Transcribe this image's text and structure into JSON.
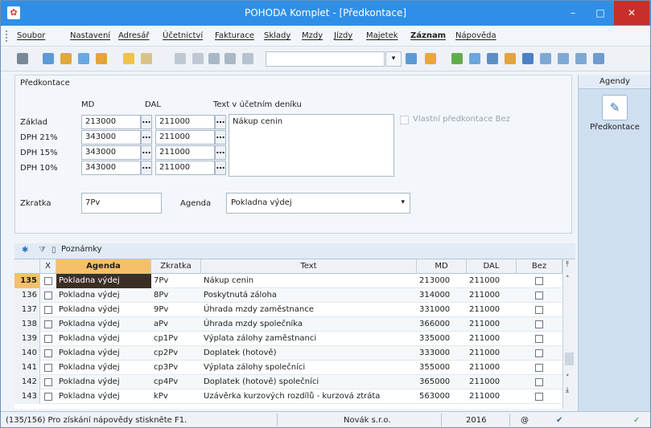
{
  "window": {
    "title": "POHODA Komplet - [Předkontace]",
    "min": "–",
    "max": "□",
    "close": "✕"
  },
  "menu": [
    "Soubor",
    "Nastavení",
    "Adresář",
    "Účetnictví",
    "Fakturace",
    "Sklady",
    "Mzdy",
    "Jízdy",
    "Majetek",
    "Záznam",
    "Nápověda"
  ],
  "form": {
    "title": "Předkontace",
    "col_md": "MD",
    "col_dal": "DAL",
    "col_text": "Text v účetním deníku",
    "rows": [
      {
        "label": "Základ",
        "md": "213000",
        "dal": "211000"
      },
      {
        "label": "DPH 21%",
        "md": "343000",
        "dal": "211000"
      },
      {
        "label": "DPH 15%",
        "md": "343000",
        "dal": "211000"
      },
      {
        "label": "DPH 10%",
        "md": "343000",
        "dal": "211000"
      }
    ],
    "text_value": "Nákup cenin",
    "vlastni_label": "Vlastní předkontace Bez",
    "zkratka_label": "Zkratka",
    "zkratka_value": "7Pv",
    "agenda_label": "Agenda",
    "agenda_value": "Pokladna výdej"
  },
  "agendas_panel": {
    "title": "Agendy",
    "item_label": "Předkontace"
  },
  "tab": {
    "label": "Poznámky"
  },
  "table": {
    "headers": [
      "X",
      "Agenda",
      "Zkratka",
      "Text",
      "MD",
      "DAL",
      "Bez"
    ],
    "rows": [
      {
        "num": "135",
        "agenda": "Pokladna výdej",
        "zkratka": "7Pv",
        "text": "Nákup cenin",
        "md": "213000",
        "dal": "211000"
      },
      {
        "num": "136",
        "agenda": "Pokladna výdej",
        "zkratka": "8Pv",
        "text": "Poskytnutá záloha",
        "md": "314000",
        "dal": "211000"
      },
      {
        "num": "137",
        "agenda": "Pokladna výdej",
        "zkratka": "9Pv",
        "text": "Úhrada mzdy zaměstnance",
        "md": "331000",
        "dal": "211000"
      },
      {
        "num": "138",
        "agenda": "Pokladna výdej",
        "zkratka": "aPv",
        "text": "Úhrada mzdy společníka",
        "md": "366000",
        "dal": "211000"
      },
      {
        "num": "139",
        "agenda": "Pokladna výdej",
        "zkratka": "cp1Pv",
        "text": "Výplata zálohy zaměstnanci",
        "md": "335000",
        "dal": "211000"
      },
      {
        "num": "140",
        "agenda": "Pokladna výdej",
        "zkratka": "cp2Pv",
        "text": "Doplatek (hotově)",
        "md": "333000",
        "dal": "211000"
      },
      {
        "num": "141",
        "agenda": "Pokladna výdej",
        "zkratka": "cp3Pv",
        "text": "Výplata zálohy společníci",
        "md": "355000",
        "dal": "211000"
      },
      {
        "num": "142",
        "agenda": "Pokladna výdej",
        "zkratka": "cp4Pv",
        "text": "Doplatek (hotově) společníci",
        "md": "365000",
        "dal": "211000"
      },
      {
        "num": "143",
        "agenda": "Pokladna výdej",
        "zkratka": "kPv",
        "text": "Uzávěrka kurzových rozdílů - kurzová ztráta",
        "md": "563000",
        "dal": "211000"
      }
    ]
  },
  "status": {
    "hint": "(135/156) Pro získání nápovědy stiskněte F1.",
    "company": "Novák s.r.o.",
    "year": "2016"
  }
}
